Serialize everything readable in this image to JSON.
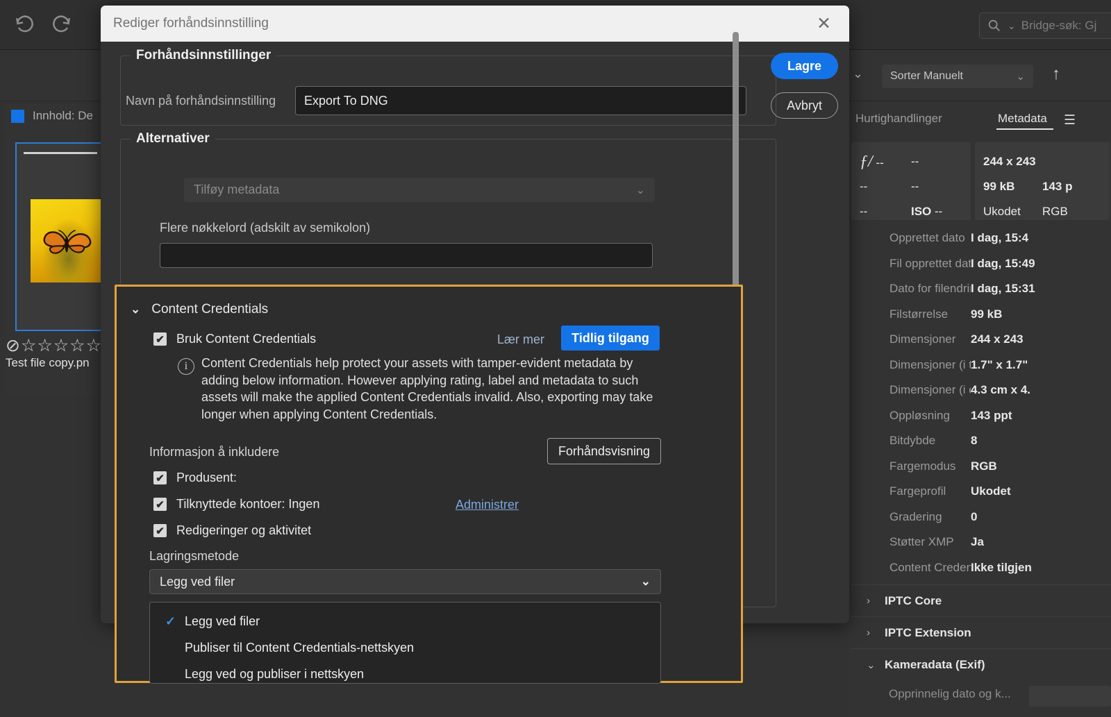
{
  "background": {
    "toolbar": {
      "undo_icon": "undo-icon",
      "redo_icon": "redo-icon",
      "search_placeholder": "Bridge-søk: Gj",
      "sort_value": "Sorter Manuelt",
      "sort_up_icon": "arrow-up-icon"
    },
    "content_panel": {
      "tab_label": "Innhold: De",
      "thumbnail": {
        "filename": "Test file copy.pn",
        "rating": "⊘☆☆☆☆☆☆"
      }
    }
  },
  "metadata_panel": {
    "tabs": {
      "quick_actions": "Hurtighandlinger",
      "metadata": "Metadata",
      "menu_icon": "hamburger-icon"
    },
    "camera_card": [
      [
        "ƒ/ --",
        "--"
      ],
      [
        "--",
        "--"
      ],
      [
        "--",
        "ISO --"
      ]
    ],
    "file_card": [
      [
        "244 x 243",
        ""
      ],
      [
        "99 kB",
        "143 p"
      ],
      [
        "Ukodet",
        "RGB"
      ]
    ],
    "rows": [
      {
        "key": "Opprettet dato",
        "value": "I dag, 15:4"
      },
      {
        "key": "Fil opprettet dato",
        "value": "I dag, 15:49"
      },
      {
        "key": "Dato for filendring",
        "value": "I dag, 15:31"
      },
      {
        "key": "Filstørrelse",
        "value": "99 kB"
      },
      {
        "key": "Dimensjoner",
        "value": "244 x 243"
      },
      {
        "key": "Dimensjoner (i tomm...",
        "value": "1.7\" x 1.7\""
      },
      {
        "key": "Dimensjoner (i cm)",
        "value": "4.3 cm x 4."
      },
      {
        "key": "Oppløsning",
        "value": "143 ppt"
      },
      {
        "key": "Bitdybde",
        "value": "8"
      },
      {
        "key": "Fargemodus",
        "value": "RGB"
      },
      {
        "key": "Fargeprofil",
        "value": "Ukodet"
      },
      {
        "key": "Gradering",
        "value": "0"
      },
      {
        "key": "Støtter XMP",
        "value": "Ja"
      },
      {
        "key": "Content Credentials",
        "value": "Ikke tilgjen"
      }
    ],
    "sections": [
      {
        "label": "IPTC Core",
        "chevron": "›"
      },
      {
        "label": "IPTC Extension",
        "chevron": "›"
      },
      {
        "label": "Kameradata (Exif)",
        "chevron": "⌄"
      }
    ],
    "exif_first_key": "Opprinnelig dato og k..."
  },
  "dialog": {
    "title": "Rediger forhåndsinnstilling",
    "close_icon": "close-icon",
    "save_label": "Lagre",
    "cancel_label": "Avbryt",
    "preset_group": {
      "legend": "Forhåndsinnstillinger",
      "name_label": "Navn på forhåndsinnstilling",
      "name_value": "Export To DNG"
    },
    "options_group": {
      "legend": "Alternativer",
      "add_metadata_placeholder": "Tilføy metadata",
      "keywords_label": "Flere nøkkelord (adskilt av semikolon)",
      "keywords_value": ""
    },
    "content_credentials": {
      "section_title": "Content Credentials",
      "chevron": "⌄",
      "use_label": "Bruk Content Credentials",
      "use_checked": "✔",
      "learn_more": "Lær mer",
      "early_access": "Tidlig tilgang",
      "info_icon": "info-icon",
      "info_text": "Content Credentials help protect your assets with tamper-evident metadata by adding below information. However applying rating, label and metadata to such assets will make the applied Content Credentials invalid. Also, exporting may take longer when applying Content Credentials.",
      "include_label": "Informasjon å inkludere",
      "preview_label": "Forhåndsvisning",
      "checkboxes": [
        {
          "label": "Produsent:",
          "checked": "✔"
        },
        {
          "label": "Tilknyttede kontoer: Ingen",
          "checked": "✔"
        },
        {
          "label": "Redigeringer og aktivitet",
          "checked": "✔"
        }
      ],
      "manage_link": "Administrer ",
      "storage_label": "Lagringsmetode",
      "storage_value": "Legg ved filer",
      "storage_options": [
        {
          "label": "Legg ved filer",
          "selected": true
        },
        {
          "label": "Publiser til Content Credentials-nettskyen",
          "selected": false
        },
        {
          "label": "Legg ved og publiser i nettskyen",
          "selected": false
        }
      ]
    },
    "highlight_color": "#e0a33c"
  }
}
